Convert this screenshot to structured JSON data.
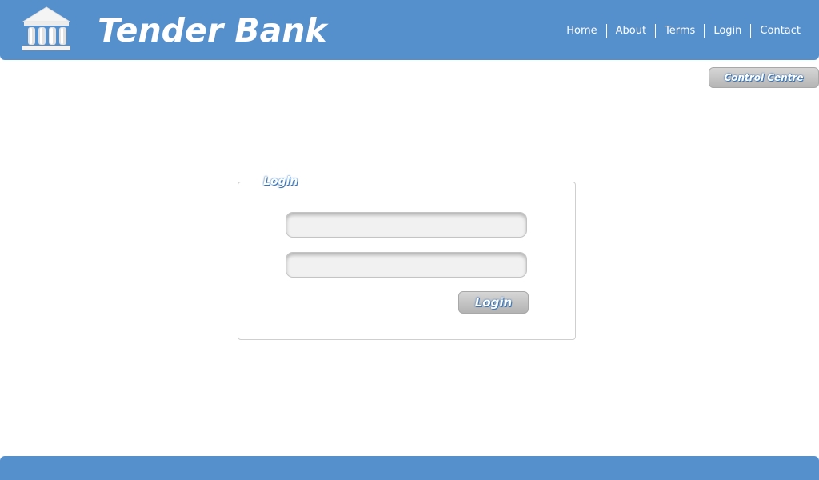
{
  "header": {
    "brand_name": "Tender Bank",
    "logo_icon": "bank-building-icon",
    "nav": [
      {
        "label": "Home"
      },
      {
        "label": "About"
      },
      {
        "label": "Terms"
      },
      {
        "label": "Login"
      },
      {
        "label": "Contact"
      }
    ]
  },
  "control_centre": {
    "label": "Control Centre"
  },
  "login": {
    "legend": "Login",
    "username": {
      "value": "",
      "placeholder": ""
    },
    "password": {
      "value": "",
      "placeholder": ""
    },
    "submit_label": "Login"
  },
  "colors": {
    "brand_blue": "#5690cc",
    "button_gray": "#c4c4c4",
    "text_outline_blue": "#3c77b8"
  }
}
